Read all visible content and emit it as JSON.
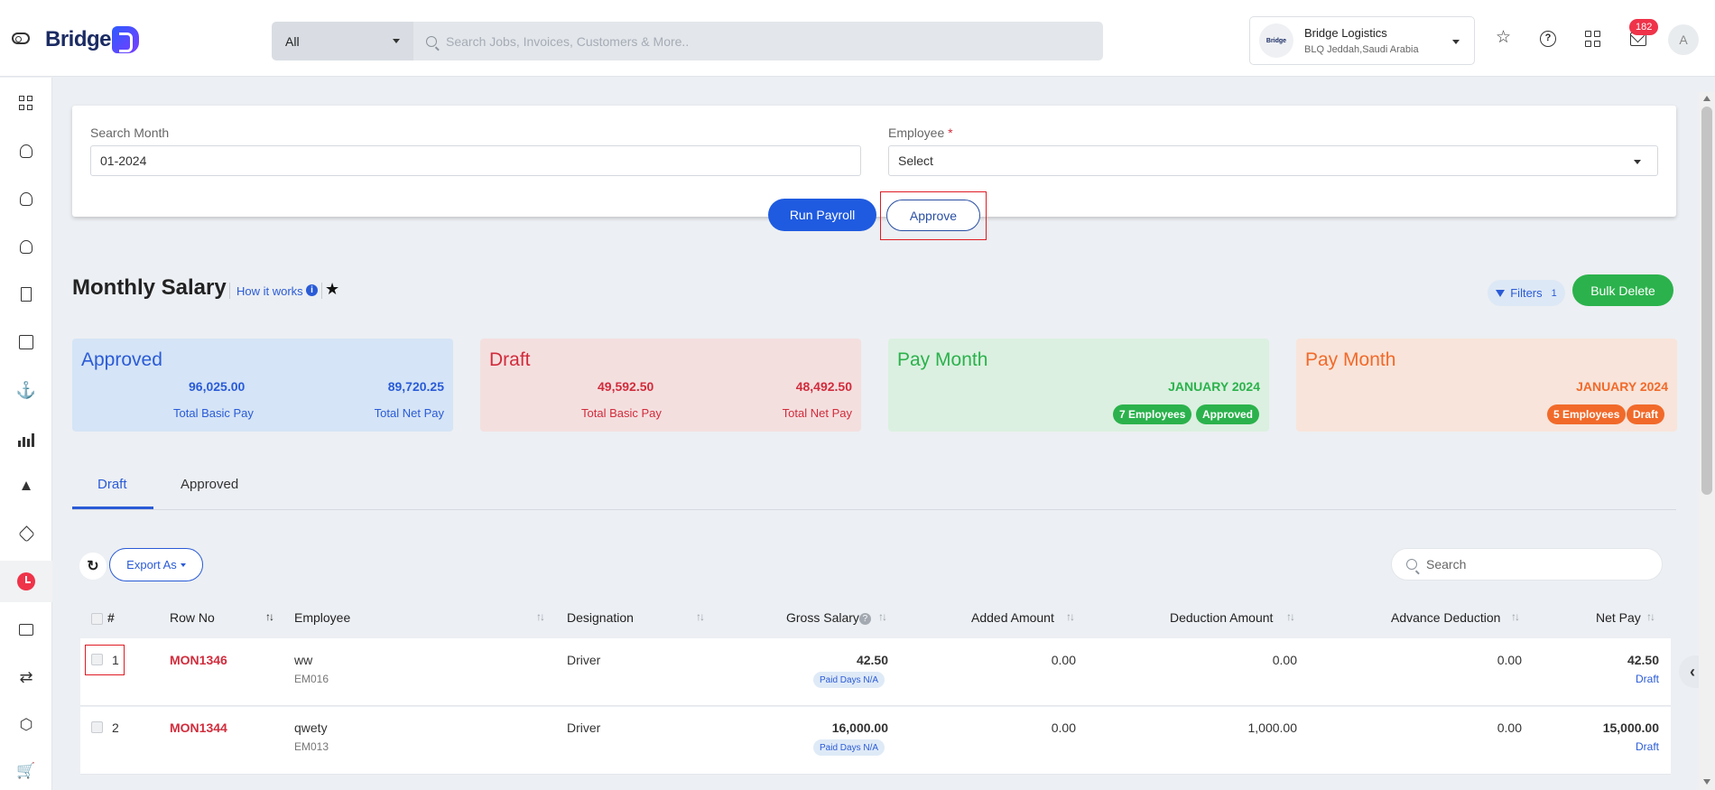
{
  "header": {
    "logo_text": "Bridge",
    "search_scope": "All",
    "search_placeholder": "Search Jobs, Invoices, Customers & More..",
    "company_name": "Bridge Logistics",
    "company_location": "BLQ Jeddah,Saudi Arabia",
    "company_logo_text": "Bridge",
    "notification_count": "182",
    "avatar_initial": "A"
  },
  "sidebar": {
    "items": [
      "dashboard-icon",
      "user-icon",
      "users-icon",
      "user-plus-icon",
      "bookmark-icon",
      "edit-icon",
      "anchor-icon",
      "bar-chart-icon",
      "navigation-icon",
      "tag-icon",
      "clock-icon",
      "credit-card-icon",
      "sync-icon",
      "package-icon",
      "cart-icon"
    ],
    "active": "clock-icon"
  },
  "filters": {
    "search_month_label": "Search Month",
    "search_month_value": "01-2024",
    "employee_label": "Employee",
    "employee_required": "*",
    "employee_value": "Select",
    "run_payroll_label": "Run Payroll",
    "approve_label": "Approve"
  },
  "page": {
    "title": "Monthly Salary",
    "how_it_works": "How it works",
    "filters_label": "Filters",
    "filters_count": "1",
    "bulk_delete_label": "Bulk Delete"
  },
  "summary": {
    "approved": {
      "title": "Approved",
      "basic": "96,025.00",
      "net": "89,720.25",
      "basic_caption": "Total Basic Pay",
      "net_caption": "Total Net Pay"
    },
    "draft": {
      "title": "Draft",
      "basic": "49,592.50",
      "net": "48,492.50",
      "basic_caption": "Total Basic Pay",
      "net_caption": "Total Net Pay"
    },
    "pay_month_approved": {
      "title": "Pay Month",
      "month": "JANUARY 2024",
      "employees": "7 Employees",
      "status": "Approved"
    },
    "pay_month_draft": {
      "title": "Pay Month",
      "month": "JANUARY 2024",
      "employees": "5 Employees",
      "status": "Draft"
    }
  },
  "tabs": [
    {
      "label": "Draft",
      "active": true
    },
    {
      "label": "Approved",
      "active": false
    }
  ],
  "table_toolbar": {
    "export_label": "Export As",
    "search_placeholder": "Search"
  },
  "table": {
    "columns": [
      "#",
      "Row No",
      "Employee",
      "Designation",
      "Gross Salary",
      "Added Amount",
      "Deduction Amount",
      "Advance Deduction",
      "Net Pay"
    ],
    "rows": [
      {
        "index": "1",
        "row_no": "MON1346",
        "employee": "ww",
        "employee_code": "EM016",
        "designation": "Driver",
        "gross": "42.50",
        "paid_days": "Paid Days N/A",
        "added": "0.00",
        "deduction": "0.00",
        "advance": "0.00",
        "net": "42.50",
        "status": "Draft"
      },
      {
        "index": "2",
        "row_no": "MON1344",
        "employee": "qwety",
        "employee_code": "EM013",
        "designation": "Driver",
        "gross": "16,000.00",
        "paid_days": "Paid Days N/A",
        "added": "0.00",
        "deduction": "1,000.00",
        "advance": "0.00",
        "net": "15,000.00",
        "status": "Draft"
      }
    ]
  },
  "colors": {
    "primary": "#1f5be0",
    "accent_blue": "#2a5bd7",
    "danger": "#d12c3c",
    "success": "#2bb24c",
    "warning": "#f16a2a"
  }
}
